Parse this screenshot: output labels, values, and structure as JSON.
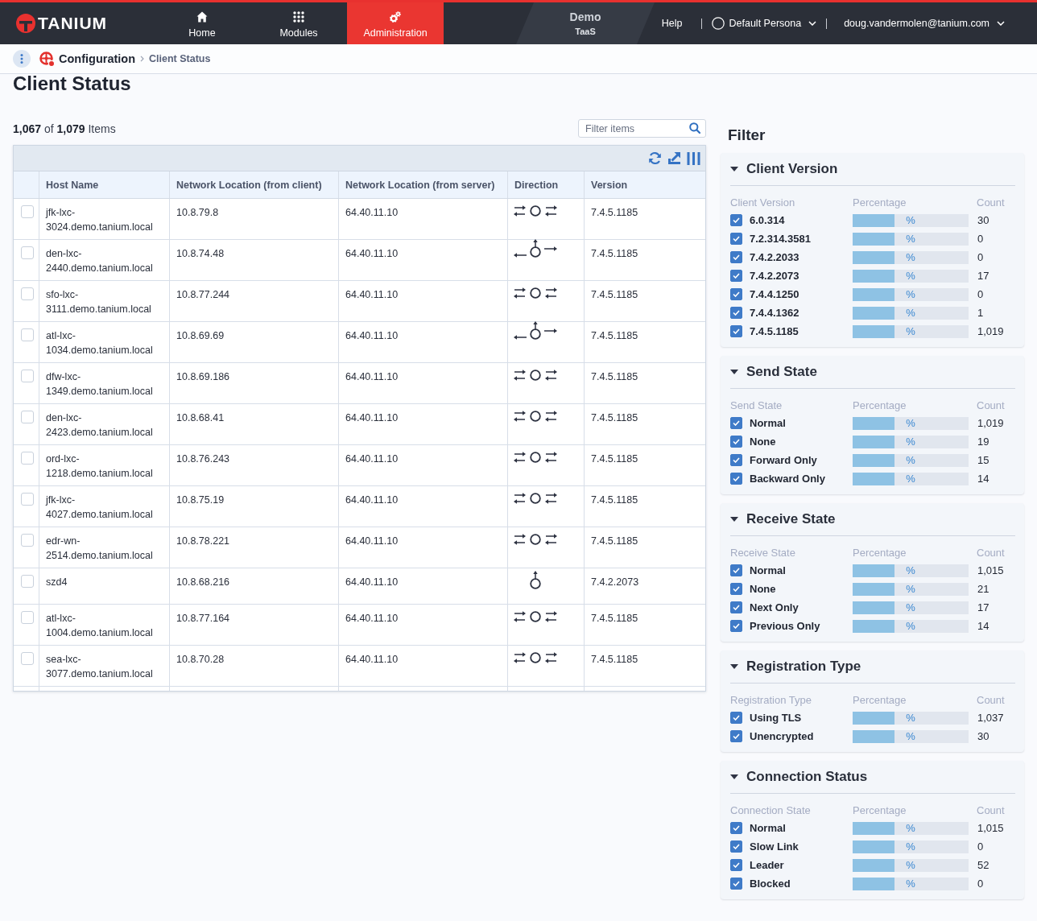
{
  "top_bar": {
    "logo": "TANIUM",
    "nav": [
      {
        "label": "Home",
        "selected": false
      },
      {
        "label": "Modules",
        "selected": false
      },
      {
        "label": "Administration",
        "selected": true
      }
    ],
    "instance": {
      "name": "Demo",
      "plan": "TaaS"
    },
    "help": "Help",
    "persona": "Default Persona",
    "user": "doug.vandermolen@tanium.com"
  },
  "breadcrumb": {
    "section": "Configuration",
    "current": "Client Status"
  },
  "page_title": "Client Status",
  "summary": "**1,067** of **1,079** Items",
  "search": {
    "placeholder": "Filter items"
  },
  "table": {
    "columns": [
      "Host Name",
      "Network Location (from client)",
      "Network Location (from server)",
      "Direction",
      "Version"
    ],
    "rows": [
      {
        "kind": "both",
        "selected": false,
        "host": "jfk-lxc-3024.demo.tanium.local",
        "client_location": "10.8.79.8",
        "server_location": "64.40.11.10",
        "version": "7.4.5.1185"
      },
      {
        "kind": "split",
        "selected": false,
        "host": "den-lxc-2440.demo.tanium.local",
        "client_location": "10.8.74.48",
        "server_location": "64.40.11.10",
        "version": "7.4.5.1185"
      },
      {
        "kind": "both",
        "selected": false,
        "host": "sfo-lxc-3111.demo.tanium.local",
        "client_location": "10.8.77.244",
        "server_location": "64.40.11.10",
        "version": "7.4.5.1185"
      },
      {
        "kind": "split",
        "selected": false,
        "host": "atl-lxc-1034.demo.tanium.local",
        "client_location": "10.8.69.69",
        "server_location": "64.40.11.10",
        "version": "7.4.5.1185"
      },
      {
        "kind": "both",
        "selected": false,
        "host": "dfw-lxc-1349.demo.tanium.local",
        "client_location": "10.8.69.186",
        "server_location": "64.40.11.10",
        "version": "7.4.5.1185"
      },
      {
        "kind": "both",
        "selected": false,
        "host": "den-lxc-2423.demo.tanium.local",
        "client_location": "10.8.68.41",
        "server_location": "64.40.11.10",
        "version": "7.4.5.1185"
      },
      {
        "kind": "both",
        "selected": false,
        "host": "ord-lxc-1218.demo.tanium.local",
        "client_location": "10.8.76.243",
        "server_location": "64.40.11.10",
        "version": "7.4.5.1185"
      },
      {
        "kind": "both",
        "selected": false,
        "host": "jfk-lxc-4027.demo.tanium.local",
        "client_location": "10.8.75.19",
        "server_location": "64.40.11.10",
        "version": "7.4.5.1185"
      },
      {
        "kind": "both",
        "selected": false,
        "host": "edr-wn-2514.demo.tanium.local",
        "client_location": "10.8.78.221",
        "server_location": "64.40.11.10",
        "version": "7.4.5.1185"
      },
      {
        "kind": "up",
        "selected": false,
        "host": "szd4",
        "client_location": "10.8.68.216",
        "server_location": "64.40.11.10",
        "version": "7.4.2.2073"
      },
      {
        "kind": "both",
        "selected": false,
        "host": "atl-lxc-1004.demo.tanium.local",
        "client_location": "10.8.77.164",
        "server_location": "64.40.11.10",
        "version": "7.4.5.1185"
      },
      {
        "kind": "both",
        "selected": false,
        "host": "sea-lxc-3077.demo.tanium.local",
        "client_location": "10.8.70.28",
        "server_location": "64.40.11.10",
        "version": "7.4.5.1185"
      }
    ]
  },
  "filter": {
    "title": "Filter",
    "sections": [
      {
        "title": "Client Version",
        "expanded": true,
        "columns": [
          "Client Version",
          "Percentage",
          "Count"
        ],
        "items": [
          {
            "label": "6.0.314",
            "checked": true,
            "level": 0.36,
            "percent": "%",
            "count": "30"
          },
          {
            "label": "7.2.314.3581",
            "checked": true,
            "level": 0.36,
            "percent": "%",
            "count": "0"
          },
          {
            "label": "7.4.2.2033",
            "checked": true,
            "level": 0.36,
            "percent": "%",
            "count": "0"
          },
          {
            "label": "7.4.2.2073",
            "checked": true,
            "level": 0.36,
            "percent": "%",
            "count": "17"
          },
          {
            "label": "7.4.4.1250",
            "checked": true,
            "level": 0.36,
            "percent": "%",
            "count": "0"
          },
          {
            "label": "7.4.4.1362",
            "checked": true,
            "level": 0.36,
            "percent": "%",
            "count": "1"
          },
          {
            "label": "7.4.5.1185",
            "checked": true,
            "level": 0.36,
            "percent": "%",
            "count": "1,019"
          }
        ]
      },
      {
        "title": "Send State",
        "expanded": true,
        "columns": [
          "Send State",
          "Percentage",
          "Count"
        ],
        "items": [
          {
            "label": "Normal",
            "checked": true,
            "level": 0.36,
            "percent": "%",
            "count": "1,019"
          },
          {
            "label": "None",
            "checked": true,
            "level": 0.36,
            "percent": "%",
            "count": "19"
          },
          {
            "label": "Forward Only",
            "checked": true,
            "level": 0.36,
            "percent": "%",
            "count": "15"
          },
          {
            "label": "Backward Only",
            "checked": true,
            "level": 0.36,
            "percent": "%",
            "count": "14"
          }
        ]
      },
      {
        "title": "Receive State",
        "expanded": true,
        "columns": [
          "Receive State",
          "Percentage",
          "Count"
        ],
        "items": [
          {
            "label": "Normal",
            "checked": true,
            "level": 0.36,
            "percent": "%",
            "count": "1,015"
          },
          {
            "label": "None",
            "checked": true,
            "level": 0.36,
            "percent": "%",
            "count": "21"
          },
          {
            "label": "Next Only",
            "checked": true,
            "level": 0.36,
            "percent": "%",
            "count": "17"
          },
          {
            "label": "Previous Only",
            "checked": true,
            "level": 0.36,
            "percent": "%",
            "count": "14"
          }
        ]
      },
      {
        "title": "Registration Type",
        "expanded": true,
        "columns": [
          "Registration Type",
          "Percentage",
          "Count"
        ],
        "items": [
          {
            "label": "Using TLS",
            "checked": true,
            "level": 0.36,
            "percent": "%",
            "count": "1,037"
          },
          {
            "label": "Unencrypted",
            "checked": true,
            "level": 0.36,
            "percent": "%",
            "count": "30"
          }
        ]
      },
      {
        "title": "Connection Status",
        "expanded": true,
        "columns": [
          "Connection State",
          "Percentage",
          "Count"
        ],
        "items": [
          {
            "label": "Normal",
            "checked": true,
            "level": 0.36,
            "percent": "%",
            "count": "1,015"
          },
          {
            "label": "Slow Link",
            "checked": true,
            "level": 0.36,
            "percent": "%",
            "count": "0"
          },
          {
            "label": "Leader",
            "checked": true,
            "level": 0.36,
            "percent": "%",
            "count": "52"
          },
          {
            "label": "Blocked",
            "checked": true,
            "level": 0.36,
            "percent": "%",
            "count": "0"
          }
        ]
      }
    ]
  }
}
